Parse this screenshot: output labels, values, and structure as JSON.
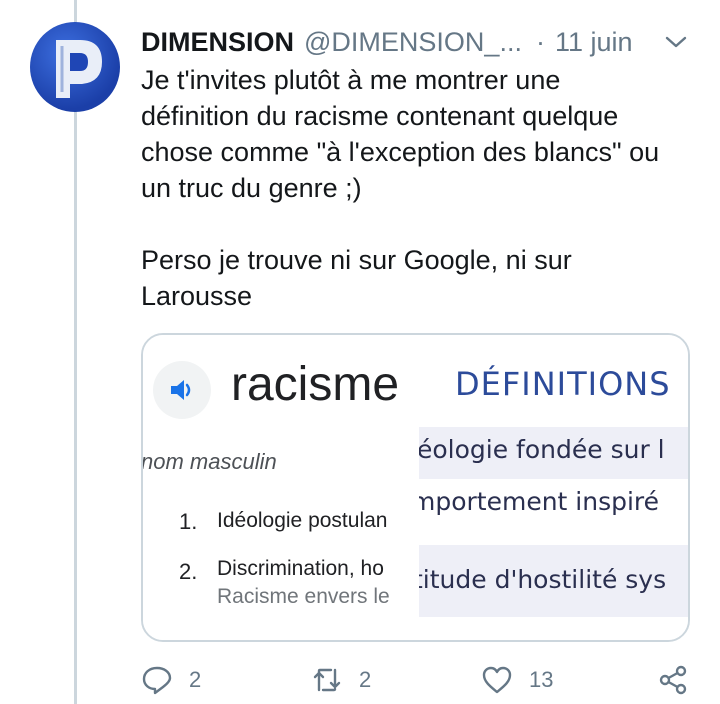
{
  "tweet": {
    "author": {
      "display_name": "DIMENSION",
      "handle": "@DIMENSION_...",
      "separator": "·",
      "date": "11 juin"
    },
    "text_paragraph_1": [
      "Je t'invites plutôt à me montrer une",
      "définition du racisme contenant quelque",
      "chose comme \"à l'exception des blancs\" ou",
      "un truc du genre ;)"
    ],
    "text_paragraph_2": [
      "Perso je trouve ni sur Google, ni sur",
      "Larousse"
    ]
  },
  "media": {
    "google": {
      "word": "racisme",
      "part_of_speech": "nom masculin",
      "definitions": [
        {
          "number": "1.",
          "text": "Idéologie postulan"
        },
        {
          "number": "2.",
          "text": "Discrimination, ho",
          "example": "Racisme envers le"
        }
      ]
    },
    "larousse": {
      "heading": "DÉFINITIONS",
      "lines": [
        "éologie fondée sur l",
        "mportement inspiré",
        "titude d'hostilité sys"
      ]
    }
  },
  "actions": {
    "reply_count": "2",
    "retweet_count": "2",
    "like_count": "13"
  },
  "colors": {
    "link_blue": "#1da1f2",
    "muted_gray": "#657786",
    "larousse_blue": "#2c4b9a",
    "google_speaker_blue": "#1a73e8"
  }
}
